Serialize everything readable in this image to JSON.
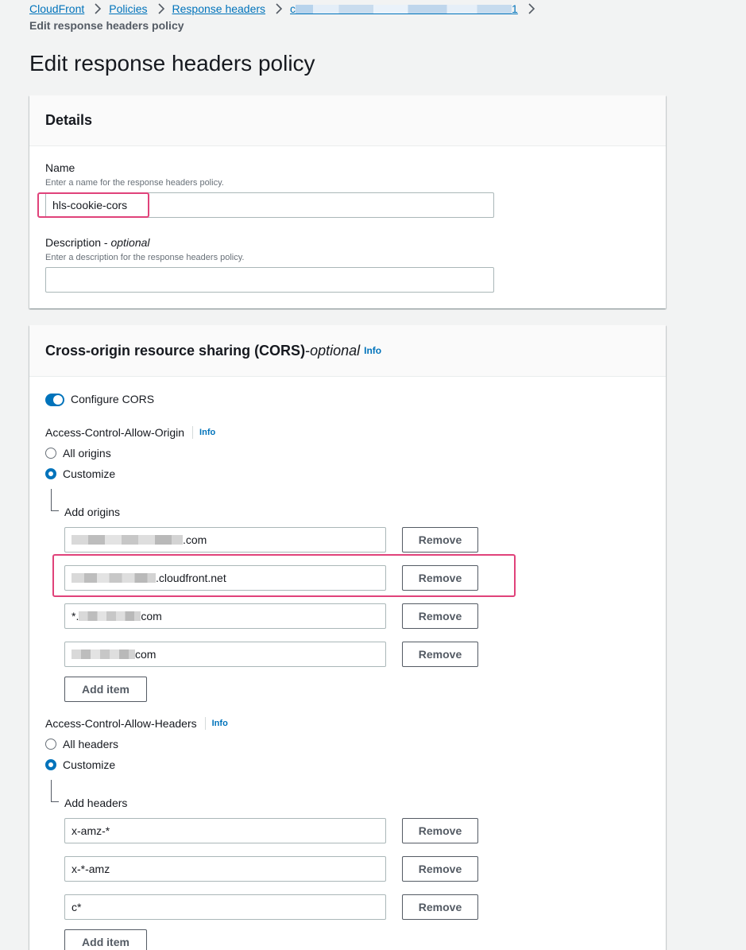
{
  "breadcrumb": {
    "items": [
      "CloudFront",
      "Policies",
      "Response headers"
    ],
    "last_visible": "c",
    "last_tail": "1",
    "current": "Edit response headers policy"
  },
  "page_title": "Edit response headers policy",
  "details": {
    "header": "Details",
    "name_label": "Name",
    "name_desc": "Enter a name for the response headers policy.",
    "name_value": "hls-cookie-cors",
    "desc_label": "Description - ",
    "desc_optional": "optional",
    "desc_desc": "Enter a description for the response headers policy.",
    "desc_value": ""
  },
  "cors": {
    "header": "Cross-origin resource sharing (CORS)",
    "header_dash": " - ",
    "header_optional": "optional",
    "info": "Info",
    "configure_label": "Configure CORS",
    "origin": {
      "label": "Access-Control-Allow-Origin",
      "info": "Info",
      "option_all": "All origins",
      "option_custom": "Customize",
      "add_label": "Add origins",
      "items": [
        {
          "suffix": ".com"
        },
        {
          "suffix": ".cloudfront.net"
        },
        {
          "prefix": "*.",
          "suffix": "com"
        },
        {
          "suffix": "com"
        }
      ],
      "remove": "Remove",
      "add_item": "Add item"
    },
    "headers": {
      "label": "Access-Control-Allow-Headers",
      "info": "Info",
      "option_all": "All headers",
      "option_custom": "Customize",
      "add_label": "Add headers",
      "items": [
        "x-amz-*",
        "x-*-amz",
        "c*"
      ],
      "remove": "Remove",
      "add_item": "Add item"
    }
  },
  "colors": {
    "accent": "#0073bb",
    "highlight": "#e0427a"
  }
}
